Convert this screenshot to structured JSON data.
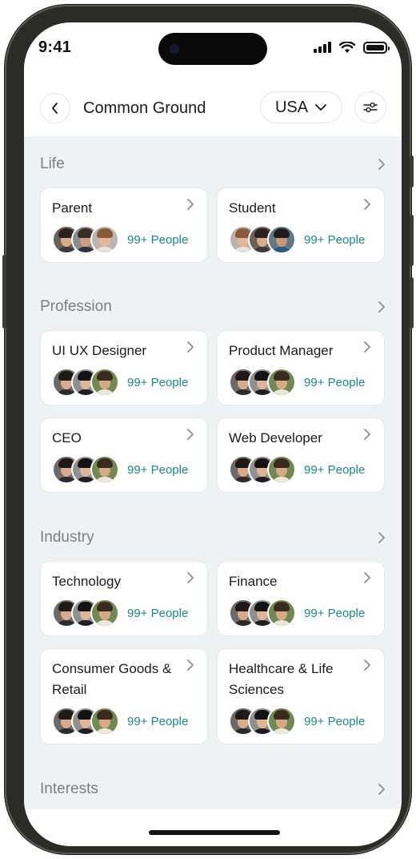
{
  "status_bar": {
    "time": "9:41"
  },
  "header": {
    "title": "Common Ground",
    "country": "USA"
  },
  "sections": [
    {
      "title": "Life",
      "cards": [
        {
          "title": "Parent",
          "people": "99+ People"
        },
        {
          "title": "Student",
          "people": "99+ People"
        }
      ]
    },
    {
      "title": "Profession",
      "cards": [
        {
          "title": "UI UX Designer",
          "people": "99+ People"
        },
        {
          "title": "Product Manager",
          "people": "99+ People"
        },
        {
          "title": "CEO",
          "people": "99+ People"
        },
        {
          "title": "Web Developer",
          "people": "99+ People"
        }
      ]
    },
    {
      "title": "Industry",
      "cards": [
        {
          "title": "Technology",
          "people": "99+ People"
        },
        {
          "title": "Finance",
          "people": "99+ People"
        },
        {
          "title": "Consumer Goods & Retail",
          "people": "99+ People"
        },
        {
          "title": "Healthcare & Life Sciences",
          "people": "99+ People"
        }
      ]
    },
    {
      "title": "Interests",
      "cards": []
    }
  ],
  "icons": {
    "back": "chevron-left-icon",
    "dropdown": "chevron-down-icon",
    "filter": "sliders-icon",
    "section_more": "chevron-right-icon",
    "card_more": "chevron-right-icon"
  },
  "colors": {
    "accent": "#1a8a86",
    "background": "#eff2f2",
    "card": "#ffffff"
  }
}
